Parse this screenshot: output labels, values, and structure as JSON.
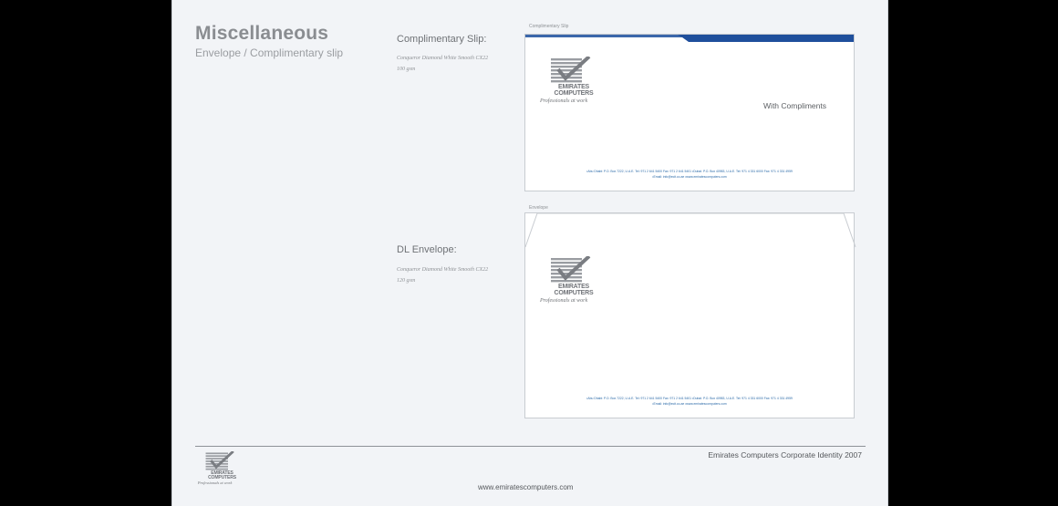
{
  "header": {
    "title": "Miscellaneous",
    "subtitle": "Envelope / Complimentary slip"
  },
  "complimentary_slip": {
    "section_label": "Complimentary Slip:",
    "spec_line1": "Conqueror Diamond White Smooth CX22",
    "spec_line2": "100 gsm",
    "caption": "Complimentary Slip",
    "accent_color": "#1f4f9c",
    "compliments_text": "With Compliments"
  },
  "dl_envelope": {
    "section_label": "DL Envelope:",
    "spec_line1": "Conqueror Diamond White Smooth CX22",
    "spec_line2": "120 gsm",
    "caption": "Envelope"
  },
  "logo": {
    "line1": "EMIRATES",
    "line2": "COMPUTERS",
    "tagline": "Professionals at work",
    "icon": "checkmark-stripes-icon"
  },
  "address": {
    "line1": "•Abu Dhabi: P.O. Box 7222, U.A.E. Tel: 971 2 641 5400 Fax: 971 2 641 5401 •Dubai: P.O. Box 40983, U.A.E. Tel: 971 4 331 6000 Fax: 971 4 331 4959",
    "line2": "•Email: info@ecit.co.ae   •www.emiratescomputers.com"
  },
  "footer": {
    "identity": "Emirates Computers Corporate Identity 2007",
    "url": "www.emiratescomputers.com"
  }
}
